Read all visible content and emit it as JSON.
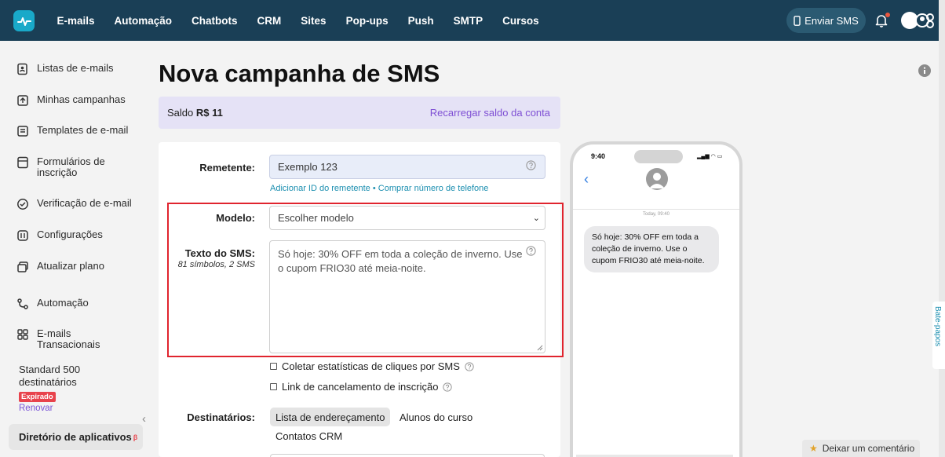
{
  "nav": {
    "items": [
      "E-mails",
      "Automação",
      "Chatbots",
      "CRM",
      "Sites",
      "Pop-ups",
      "Push",
      "SMTP",
      "Cursos"
    ],
    "send_sms_label": "Enviar SMS"
  },
  "sidebar": {
    "items": [
      {
        "label": "Listas de e-mails",
        "icon": "contact-list-icon"
      },
      {
        "label": "Minhas campanhas",
        "icon": "campaign-icon"
      },
      {
        "label": "Templates de e-mail",
        "icon": "template-icon"
      },
      {
        "label": "Formulários de inscrição",
        "icon": "form-icon"
      },
      {
        "label": "Verificação de e-mail",
        "icon": "check-circle-icon"
      },
      {
        "label": "Configurações",
        "icon": "settings-icon"
      },
      {
        "label": "Atualizar plano",
        "icon": "upgrade-icon"
      },
      {
        "label": "Automação",
        "icon": "automation-icon"
      },
      {
        "label": "E-mails Transacionais",
        "icon": "grid-icon"
      }
    ],
    "plan_text": "Standard 500 destinatários",
    "expired_badge": "Expirado",
    "renew_label": "Renovar",
    "app_directory_label": "Diretório de aplicativos",
    "app_directory_badge": "β"
  },
  "main": {
    "title": "Nova campanha de SMS",
    "balance_label": "Saldo",
    "balance_value": "R$ 11",
    "recharge_label": "Recarregar saldo da conta",
    "form": {
      "sender_label": "Remetente:",
      "sender_value": "Exemplo 123",
      "add_sender_link": "Adicionar ID do remetente",
      "links_separator": "•",
      "buy_number_link": "Comprar número de telefone",
      "template_label": "Modelo:",
      "template_placeholder": "Escolher modelo",
      "sms_text_label": "Texto do SMS:",
      "sms_counter": "81 símbolos, 2 SMS",
      "sms_text_value": "Só hoje: 30% OFF em toda a coleção de inverno. Use o cupom FRIO30 até meia-noite.",
      "collect_stats_label": "Coletar estatísticas de cliques por SMS",
      "unsubscribe_link_label": "Link de cancelamento de inscrição",
      "recipients_label": "Destinatários:",
      "recipient_options": [
        "Lista de endereçamento",
        "Alunos do curso",
        "Contatos CRM"
      ]
    }
  },
  "phone_preview": {
    "time": "9:40",
    "date_label": "Today, 09:40",
    "message": "Só hoje: 30% OFF em toda a coleção de inverno. Use o cupom FRIO30 até meia-noite."
  },
  "feedback_label": "Deixar um comentário",
  "chat_tab_label": "Bate-papos",
  "colors": {
    "topbar": "#1a3f56",
    "brand": "#19a9c9",
    "accent_purple": "#7e4fd4",
    "highlight_red": "#e0242e"
  }
}
